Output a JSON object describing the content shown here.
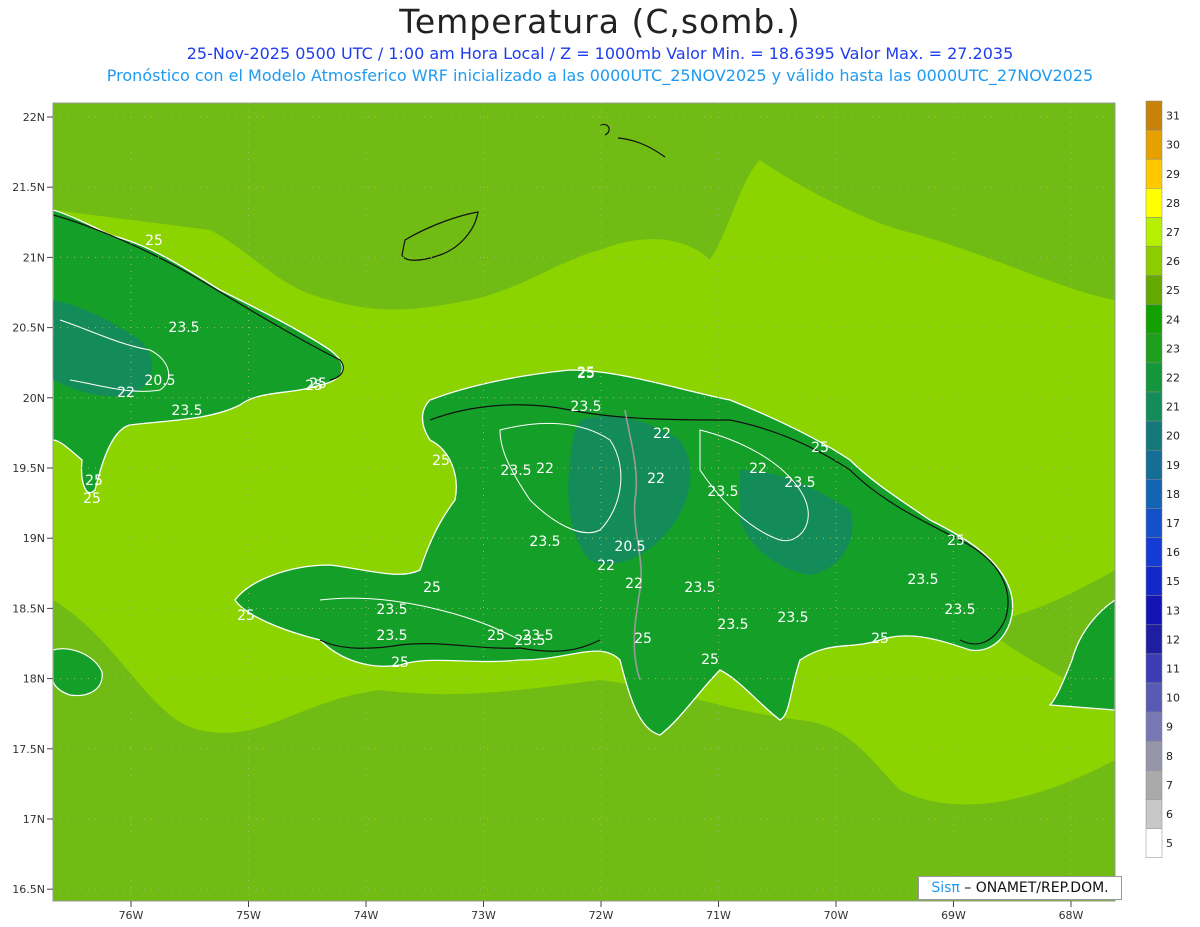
{
  "header": {
    "title": "Temperatura (C,somb.)",
    "line1": "25-Nov-2025  0500 UTC / 1:00 am Hora Local / Z = 1000mb    Valor Min. = 18.6395   Valor Max. = 27.2035",
    "line2": "Pronóstico con el Modelo Atmosferico WRF inicializado a las 0000UTC_25NOV2025 y válido hasta las  0000UTC_27NOV2025"
  },
  "axes": {
    "lat_labels": [
      "22N",
      "21.5N",
      "21N",
      "20.5N",
      "20N",
      "19.5N",
      "19N",
      "18.5N",
      "18N",
      "17.5N",
      "17N",
      "16.5N"
    ],
    "lon_labels": [
      "76W",
      "75W",
      "74W",
      "73W",
      "72W",
      "71W",
      "70W",
      "69W",
      "68W"
    ]
  },
  "colorbar": {
    "labels": [
      "31",
      "30",
      "29",
      "28",
      "27",
      "26",
      "25",
      "24",
      "23",
      "22",
      "21",
      "20",
      "19",
      "18",
      "17",
      "16",
      "15",
      "13",
      "12",
      "11",
      "10",
      "9",
      "8",
      "7",
      "6",
      "5"
    ],
    "colors": [
      "#c8820a",
      "#e6a000",
      "#ffc800",
      "#ffff00",
      "#b4f000",
      "#8ccc00",
      "#64a800",
      "#14a000",
      "#1ea01e",
      "#14963c",
      "#148c5a",
      "#147878",
      "#146e96",
      "#1464b4",
      "#1450c8",
      "#143cd2",
      "#1428c8",
      "#1414b4",
      "#1e1ea0",
      "#3c3cb4",
      "#5a5ab4",
      "#7878b4",
      "#9696aa",
      "#aaaaaa",
      "#c8c8c8",
      "#ffffff"
    ]
  },
  "contour_labels": [
    {
      "text": "25"
    },
    {
      "text": "23.5"
    },
    {
      "text": "20.5"
    },
    {
      "text": "22"
    },
    {
      "text": "23.5"
    },
    {
      "text": "25"
    },
    {
      "text": "25"
    },
    {
      "text": "25"
    },
    {
      "text": "23.5"
    },
    {
      "text": "25"
    },
    {
      "text": "22"
    },
    {
      "text": "23.5"
    },
    {
      "text": "22"
    },
    {
      "text": "25"
    },
    {
      "text": "23.5"
    },
    {
      "text": "22"
    },
    {
      "text": "22"
    },
    {
      "text": "23.5"
    },
    {
      "text": "22"
    },
    {
      "text": "23.5"
    },
    {
      "text": "25"
    },
    {
      "text": "23.5"
    },
    {
      "text": "20.5"
    },
    {
      "text": "22"
    },
    {
      "text": "25"
    },
    {
      "text": "23.5"
    },
    {
      "text": "23.5"
    },
    {
      "text": "25"
    },
    {
      "text": "25"
    },
    {
      "text": "23.5"
    },
    {
      "text": "23.5"
    },
    {
      "text": "23.5"
    },
    {
      "text": "23.5"
    },
    {
      "text": "25"
    },
    {
      "text": "25"
    },
    {
      "text": "25"
    },
    {
      "text": "25"
    },
    {
      "text": "23.5"
    },
    {
      "text": "25"
    },
    {
      "text": "25"
    },
    {
      "text": "23.5"
    },
    {
      "text": "25"
    }
  ],
  "credit": {
    "sis": "Sisπ",
    "rest": " – ONAMET/REP.DOM."
  },
  "colors": {
    "sea_warm": "#8cd400",
    "sea": "#70bc14",
    "land": "#14a028",
    "land_cool": "#148c5a"
  }
}
